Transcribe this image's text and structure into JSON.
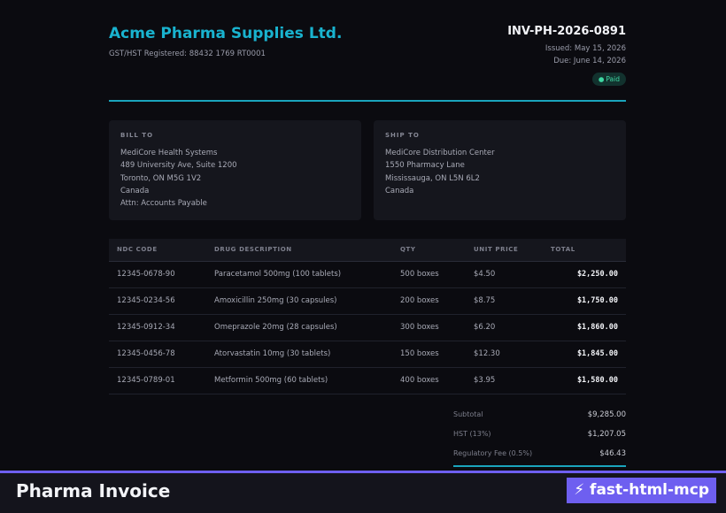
{
  "company": {
    "name": "Acme Pharma Supplies Ltd.",
    "registration": "GST/HST Registered: 88432 1769 RT0001"
  },
  "invoice": {
    "number": "INV-PH-2026-0891",
    "issued": "Issued: May 15, 2026",
    "due": "Due: June 14, 2026",
    "status_dot": "●",
    "status": "Paid",
    "status_color": "#3ed7a2"
  },
  "bill_to": {
    "title": "BILL TO",
    "lines": [
      "MediCore Health Systems",
      "489 University Ave, Suite 1200",
      "Toronto, ON M5G 1V2",
      "Canada",
      "Attn: Accounts Payable"
    ]
  },
  "ship_to": {
    "title": "SHIP TO",
    "lines": [
      "MediCore Distribution Center",
      "1550 Pharmacy Lane",
      "Mississauga, ON L5N 6L2",
      "Canada"
    ]
  },
  "table": {
    "headers": {
      "ndc": "NDC CODE",
      "description": "DRUG DESCRIPTION",
      "qty": "QTY",
      "unit_price": "UNIT PRICE",
      "total": "TOTAL"
    },
    "rows": [
      {
        "ndc": "12345-0678-90",
        "description": "Paracetamol 500mg (100 tablets)",
        "qty": "500 boxes",
        "unit_price": "$4.50",
        "total": "$2,250.00"
      },
      {
        "ndc": "12345-0234-56",
        "description": "Amoxicillin 250mg (30 capsules)",
        "qty": "200 boxes",
        "unit_price": "$8.75",
        "total": "$1,750.00"
      },
      {
        "ndc": "12345-0912-34",
        "description": "Omeprazole 20mg (28 capsules)",
        "qty": "300 boxes",
        "unit_price": "$6.20",
        "total": "$1,860.00"
      },
      {
        "ndc": "12345-0456-78",
        "description": "Atorvastatin 10mg (30 tablets)",
        "qty": "150 boxes",
        "unit_price": "$12.30",
        "total": "$1,845.00"
      },
      {
        "ndc": "12345-0789-01",
        "description": "Metformin 500mg (60 tablets)",
        "qty": "400 boxes",
        "unit_price": "$3.95",
        "total": "$1,580.00"
      }
    ]
  },
  "summary": {
    "subtotal_label": "Subtotal",
    "subtotal": "$9,285.00",
    "hst_label": "HST (13%)",
    "hst": "$1,207.05",
    "fee_label": "Regulatory Fee (0.5%)",
    "fee": "$46.43"
  },
  "footer": {
    "title": "Pharma Invoice",
    "brand": "⚡ fast-html-mcp"
  },
  "colors": {
    "accent": "#19b3cf",
    "brand": "#6e5ff0",
    "background": "#0b0b10"
  }
}
